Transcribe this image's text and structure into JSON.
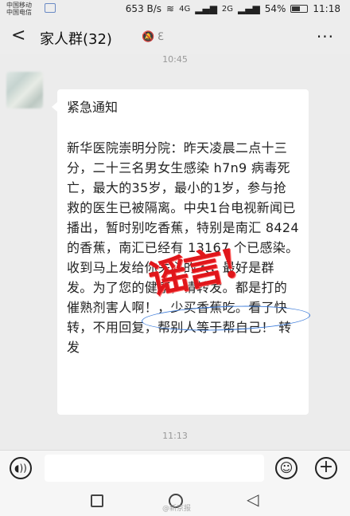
{
  "status_bar": {
    "carrier1": "中国移动",
    "carrier2": "中国电信",
    "network_speed": "653 B/s",
    "signal1": "4G",
    "signal2": "2G",
    "battery": "54%",
    "time": "11:18"
  },
  "header": {
    "title": "家人群(32)"
  },
  "chat": {
    "time_top": "10:45",
    "message_title": "紧急通知",
    "message_body": "新华医院崇明分院：昨天凌晨二点十三分，二十三名男女生感染 h7n9 病毒死亡，最大的35岁，最小的1岁，参与抢救的医生已被隔离。中央1台电视新闻已播出，暂时别吃香蕉，特别是南汇 8424 的香蕉，南汇已经有 13167 个已感染。收到马上发给你关心的人，最好是群发。为了您的健康，请转发。都是打的催熟剂害人啊！，少买香蕉吃。看了快转，不用回复，帮别人等于帮自己！ 转发",
    "stamp_text": "谣言!",
    "time_bottom": "11:13"
  },
  "watermark": "@新京报",
  "colors": {
    "stamp": "#e0161b",
    "highlight_ellipse": "#3a7ad9",
    "background": "#ededed"
  }
}
